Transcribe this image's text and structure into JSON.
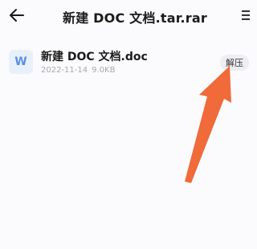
{
  "header": {
    "title": "新建 DOC 文档.tar.rar",
    "back_icon": "back-arrow-icon",
    "menu_icon": "hamburger-menu-icon"
  },
  "file": {
    "icon_letter": "W",
    "icon_name": "word-document-icon",
    "name": "新建 DOC 文档.doc",
    "date": "2022-11-14",
    "size": "9.0KB",
    "extract_label": "解压"
  },
  "colors": {
    "background": "#fbfbfd",
    "annotation_arrow": "#f06a3a",
    "doc_icon_bg": "#e8f0fb",
    "doc_icon_fg": "#5b8fe0"
  }
}
